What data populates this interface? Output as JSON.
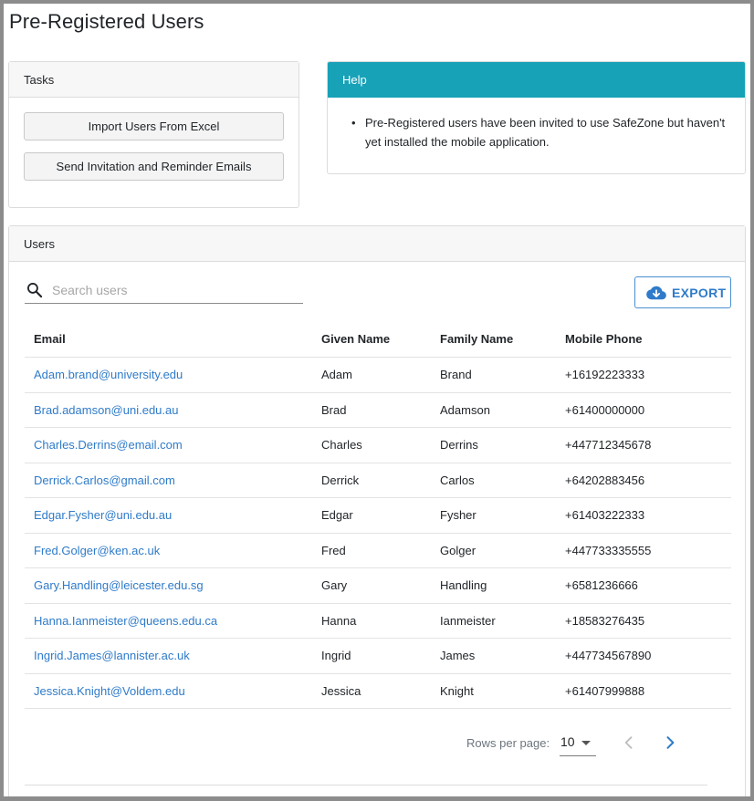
{
  "page": {
    "title": "Pre-Registered Users"
  },
  "tasks": {
    "header": "Tasks",
    "buttons": {
      "import": "Import Users From Excel",
      "invite": "Send Invitation and Reminder Emails"
    }
  },
  "help": {
    "header": "Help",
    "items": [
      "Pre-Registered users have been invited to use SafeZone but haven't yet installed the mobile application."
    ]
  },
  "users": {
    "header": "Users",
    "search": {
      "placeholder": "Search users",
      "value": ""
    },
    "export_label": "EXPORT",
    "columns": {
      "email": "Email",
      "given": "Given Name",
      "family": "Family Name",
      "phone": "Mobile Phone"
    },
    "rows": [
      {
        "email": "Adam.brand@university.edu",
        "given": "Adam",
        "family": "Brand",
        "phone": "+16192223333"
      },
      {
        "email": "Brad.adamson@uni.edu.au",
        "given": "Brad",
        "family": "Adamson",
        "phone": "+61400000000"
      },
      {
        "email": "Charles.Derrins@email.com",
        "given": "Charles",
        "family": "Derrins",
        "phone": "+447712345678"
      },
      {
        "email": "Derrick.Carlos@gmail.com",
        "given": "Derrick",
        "family": "Carlos",
        "phone": "+64202883456"
      },
      {
        "email": "Edgar.Fysher@uni.edu.au",
        "given": "Edgar",
        "family": "Fysher",
        "phone": "+61403222333"
      },
      {
        "email": "Fred.Golger@ken.ac.uk",
        "given": "Fred",
        "family": "Golger",
        "phone": "+447733335555"
      },
      {
        "email": "Gary.Handling@leicester.edu.sg",
        "given": "Gary",
        "family": "Handling",
        "phone": "+6581236666"
      },
      {
        "email": "Hanna.Ianmeister@queens.edu.ca",
        "given": "Hanna",
        "family": "Ianmeister",
        "phone": "+18583276435"
      },
      {
        "email": "Ingrid.James@lannister.ac.uk",
        "given": "Ingrid",
        "family": "James",
        "phone": "+447734567890"
      },
      {
        "email": "Jessica.Knight@Voldem.edu",
        "given": "Jessica",
        "family": "Knight",
        "phone": "+61407999888"
      }
    ],
    "pagination": {
      "rows_per_page_label": "Rows per page:",
      "rows_per_page": "10"
    }
  },
  "colors": {
    "accent": "#2f7bc9",
    "help_header": "#17a2b8"
  },
  "icons": [
    "search-icon",
    "cloud-download-icon",
    "chevron-down-icon",
    "chevron-left-icon",
    "chevron-right-icon"
  ]
}
